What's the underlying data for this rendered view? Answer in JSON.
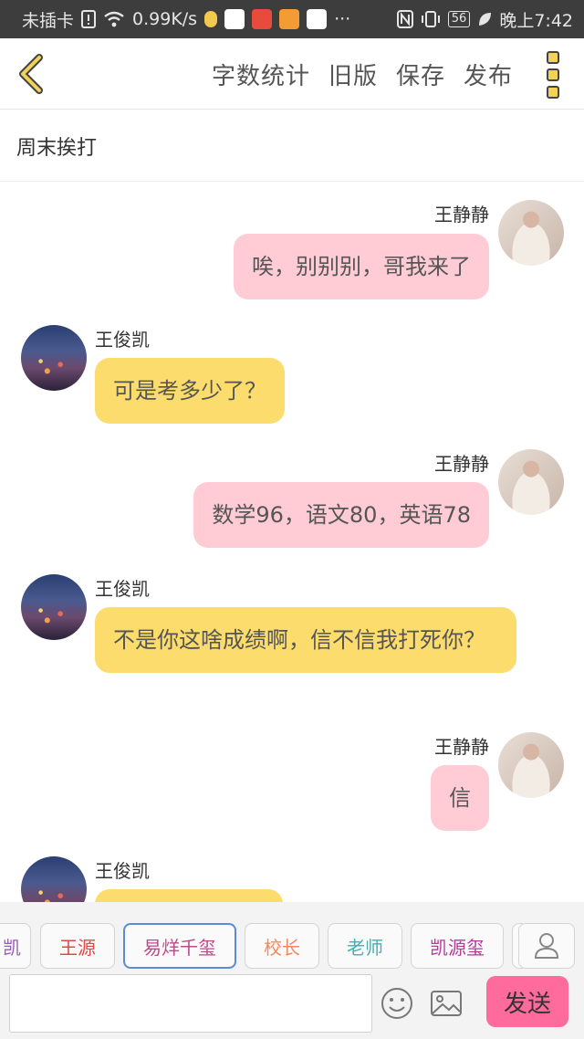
{
  "status_bar": {
    "carrier": "未插卡",
    "speed": "0.99K/s",
    "battery": "56",
    "time": "晚上7:42",
    "more": "···"
  },
  "toolbar": {
    "word_count": "字数统计",
    "old_version": "旧版",
    "save": "保存",
    "publish": "发布"
  },
  "story_title": "周末挨打",
  "messages": [
    {
      "sender": "王静静",
      "text": "唉，别别别，哥我来了",
      "side": "right"
    },
    {
      "sender": "王俊凯",
      "text": "可是考多少了？",
      "side": "left"
    },
    {
      "sender": "王静静",
      "text": "数学96，语文80，英语78",
      "side": "right"
    },
    {
      "sender": "王俊凯",
      "text": "不是你这啥成绩啊，信不信我打死你？",
      "side": "left"
    },
    {
      "sender": "王静静",
      "text": "信",
      "side": "right"
    },
    {
      "sender": "王俊凯",
      "text": "",
      "side": "left"
    }
  ],
  "characters": [
    {
      "name": "凯",
      "color": "#9b59b6"
    },
    {
      "name": "王源",
      "color": "#e04848"
    },
    {
      "name": "易烊千玺",
      "color": "#c0488a"
    },
    {
      "name": "校长",
      "color": "#f08a5d"
    },
    {
      "name": "老师",
      "color": "#3bb3b3"
    },
    {
      "name": "凯源玺",
      "color": "#b23a9a"
    }
  ],
  "input": {
    "value": "",
    "placeholder": ""
  },
  "send_label": "发送",
  "colors": {
    "right_bubble": "#ffccd6",
    "left_bubble": "#fcdc6c",
    "send_button": "#ff6b9c",
    "selected_chip_border": "#5b8ad6"
  }
}
